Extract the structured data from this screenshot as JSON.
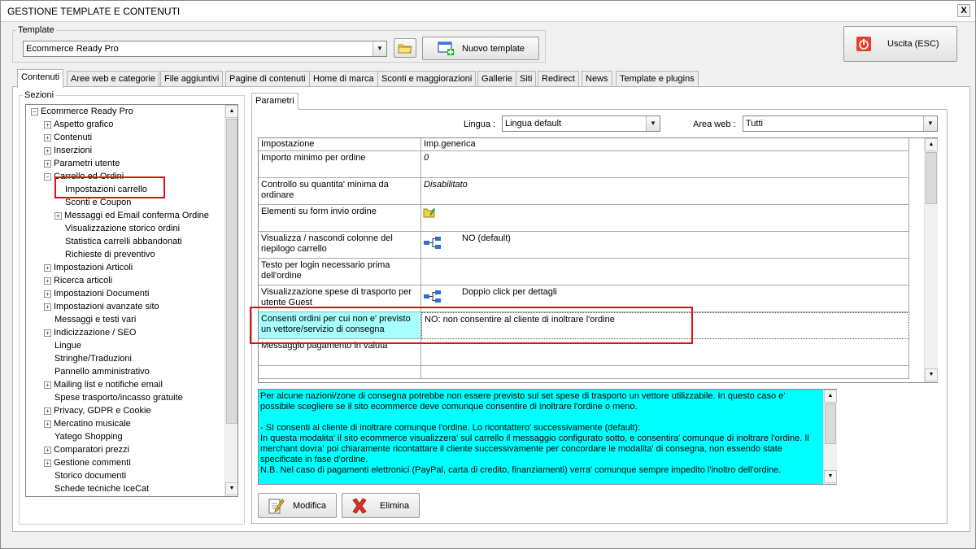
{
  "window": {
    "title": "GESTIONE TEMPLATE E CONTENUTI",
    "close_label": "X"
  },
  "template_group": {
    "legend": "Template",
    "selected": "Ecommerce Ready Pro",
    "new_button": "Nuovo template"
  },
  "exit_button": "Uscita (ESC)",
  "tabs": [
    "Contenuti",
    "Aree web e categorie",
    "File aggiuntivi",
    "Pagine di contenuti",
    "Home di marca",
    "Sconti e maggiorazioni",
    "Gallerie",
    "Siti",
    "Redirect",
    "News",
    "Template e plugins"
  ],
  "active_tab": "Contenuti",
  "sections": {
    "legend": "Sezioni",
    "items": [
      {
        "label": "Ecommerce Ready Pro",
        "exp": "−"
      },
      {
        "label": "Aspetto grafico",
        "exp": "+"
      },
      {
        "label": "Contenuti",
        "exp": "+"
      },
      {
        "label": "Inserzioni",
        "exp": "+"
      },
      {
        "label": "Parametri utente",
        "exp": "+"
      },
      {
        "label": "Carrello ed Ordini",
        "exp": "−"
      },
      {
        "label": "Impostazioni carrello",
        "exp": ""
      },
      {
        "label": "Sconti e Coupon",
        "exp": ""
      },
      {
        "label": "Messaggi ed Email conferma Ordine",
        "exp": "+"
      },
      {
        "label": "Visualizzazione storico ordini",
        "exp": ""
      },
      {
        "label": "Statistica carrelli abbandonati",
        "exp": ""
      },
      {
        "label": "Richieste di preventivo",
        "exp": ""
      },
      {
        "label": "Impostazioni Articoli",
        "exp": "+"
      },
      {
        "label": "Ricerca articoli",
        "exp": "+"
      },
      {
        "label": "Impostazioni Documenti",
        "exp": "+"
      },
      {
        "label": "Impostazioni avanzate sito",
        "exp": "+"
      },
      {
        "label": "Messaggi e testi vari",
        "exp": ""
      },
      {
        "label": "Indicizzazione / SEO",
        "exp": "+"
      },
      {
        "label": "Lingue",
        "exp": ""
      },
      {
        "label": "Stringhe/Traduzioni",
        "exp": ""
      },
      {
        "label": "Pannello amministrativo",
        "exp": ""
      },
      {
        "label": "Mailing list e notifiche email",
        "exp": "+"
      },
      {
        "label": "Spese trasporto/incasso gratuite",
        "exp": ""
      },
      {
        "label": "Privacy, GDPR e Cookie",
        "exp": "+"
      },
      {
        "label": "Mercatino musicale",
        "exp": "+"
      },
      {
        "label": "Yatego Shopping",
        "exp": ""
      },
      {
        "label": "Comparatori prezzi",
        "exp": "+"
      },
      {
        "label": "Gestione commenti",
        "exp": "+"
      },
      {
        "label": "Storico documenti",
        "exp": ""
      },
      {
        "label": "Schede tecniche IceCat",
        "exp": ""
      }
    ]
  },
  "params_tab": "Parametri",
  "filters": {
    "lingua_label": "Lingua :",
    "lingua_value": "Lingua default",
    "area_label": "Area web :",
    "area_value": "Tutti"
  },
  "grid": {
    "col1": "Impostazione",
    "col2": "Imp.generica",
    "rows": [
      {
        "setting": "Importo minimo per ordine",
        "value": "0",
        "icon": "",
        "italic": true
      },
      {
        "setting": "Controllo su quantita' minima da ordinare",
        "value": "Disabilitato",
        "icon": "",
        "italic": true
      },
      {
        "setting": "Elementi su form invio ordine",
        "value": "",
        "icon": "folder-edit-icon",
        "italic": false
      },
      {
        "setting": "Visualizza / nascondi colonne del riepilogo carrello",
        "value": "NO (default)",
        "icon": "hierarchy-icon",
        "italic": false
      },
      {
        "setting": "Testo per login necessario prima dell'ordine",
        "value": "",
        "icon": "",
        "italic": false
      },
      {
        "setting": "Visualizzazione spese di trasporto per utente Guest",
        "value": "Doppio click per dettagli",
        "icon": "hierarchy-icon",
        "italic": false
      },
      {
        "setting": "Consenti ordini per cui non e' previsto un vettore/servizio di consegna",
        "value": "NO: non consentire al cliente di inoltrare l'ordine",
        "icon": "",
        "italic": false
      },
      {
        "setting": "Messaggio pagamento in valuta",
        "value": "",
        "icon": "",
        "italic": false
      },
      {
        "setting": "",
        "value": "",
        "icon": "",
        "italic": false
      }
    ]
  },
  "description": {
    "p1": "Per alcune nazioni/zone di consegna potrebbe non essere previsto sul set spese di trasporto un vettore utilizzabile. In questo caso e' possibile scegliere se il sito ecommerce deve comunque consentire di inoltrare l'ordine o meno.",
    "p2": "- SI consenti al cliente di inoltrare comunque l'ordine. Lo ricontattero' successivamente (default):",
    "p3": "In questa modalita' il sito ecommerce visualizzera' sul carrello il messaggio configurato sotto, e consentira' comunque di inoltrare l'ordine. Il merchant dovra' poi chiaramente ricontattare il cliente successivamente per concordare le modalita' di consegna, non essendo state specificate in fase d'ordine.",
    "p4": "N.B. Nel caso di pagamenti elettronici (PayPal, carta di credito, finanziamenti) verra' comunque sempre impedito l'inoltro dell'ordine."
  },
  "buttons": {
    "modifica": "Modifica",
    "elimina": "Elimina"
  },
  "colors": {
    "selected_row": "#a7ffff",
    "description_bg": "#00ffff",
    "highlight": "#e01010"
  }
}
